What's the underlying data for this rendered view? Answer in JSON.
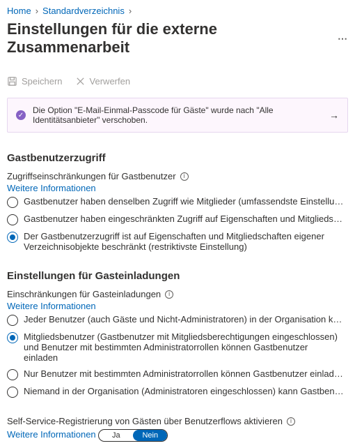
{
  "breadcrumb": {
    "home": "Home",
    "dir": "Standardverzeichnis"
  },
  "title": "Einstellungen für die externe Zusammenarbeit",
  "toolbar": {
    "save": "Speichern",
    "discard": "Verwerfen"
  },
  "banner": {
    "text": "Die Option \"E-Mail-Einmal-Passcode für Gäste\" wurde nach \"Alle Identitätsanbieter\" verschoben."
  },
  "guestAccess": {
    "heading": "Gastbenutzerzugriff",
    "subheading": "Zugriffseinschränkungen für Gastbenutzer",
    "learnMore": "Weitere Informationen",
    "options": [
      "Gastbenutzer haben denselben Zugriff wie Mitglieder (umfassendste Einstellung)",
      "Gastbenutzer haben eingeschränkten Zugriff auf Eigenschaften und Mitgliedschaften von Verzeic...",
      "Der Gastbenutzerzugriff ist auf Eigenschaften und Mitgliedschaften eigener Verzeichnisobjekte beschränkt (restriktivste Einstellung)"
    ],
    "selected": 2
  },
  "inviteSettings": {
    "heading": "Einstellungen für Gasteinladungen",
    "subheading": "Einschränkungen für Gasteinladungen",
    "learnMore": "Weitere Informationen",
    "options": [
      "Jeder Benutzer (auch Gäste und Nicht-Administratoren) in der Organisation kann Gastbenutzer ei...",
      "Mitgliedsbenutzer (Gastbenutzer mit Mitgliedsberechtigungen eingeschlossen) und Benutzer mit bestimmten Administratorrollen können Gastbenutzer einladen",
      "Nur Benutzer mit bestimmten Administratorrollen können Gastbenutzer einladen",
      "Niemand in der Organisation (Administratoren eingeschlossen) kann Gastbenutzer einladen (restri..."
    ],
    "selected": 1
  },
  "selfService": {
    "label": "Self-Service-Registrierung von Gästen über Benutzerflows aktivieren",
    "learnMore": "Weitere Informationen",
    "yes": "Ja",
    "no": "Nein",
    "value": "Nein"
  }
}
